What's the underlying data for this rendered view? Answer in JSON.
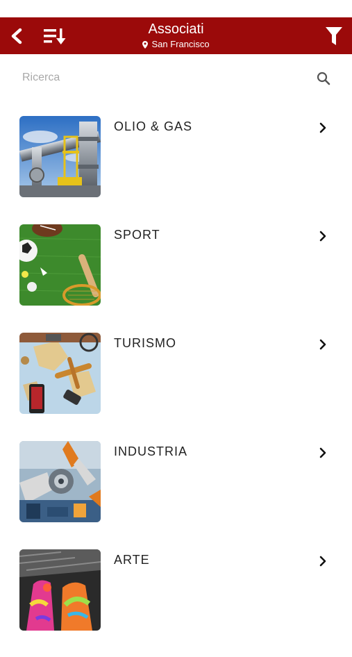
{
  "header": {
    "title": "Associati",
    "location": "San Francisco",
    "background_color": "#9b0a0a",
    "icons": [
      "back-arrow-icon",
      "sort-icon",
      "filter-icon",
      "map-pin-icon"
    ]
  },
  "search": {
    "placeholder": "Ricerca",
    "value": ""
  },
  "categories": [
    {
      "label": "OLIO & GAS",
      "image": "oil-gas-pipes-image"
    },
    {
      "label": "SPORT",
      "image": "sports-equipment-image"
    },
    {
      "label": "TURISMO",
      "image": "travel-map-image"
    },
    {
      "label": "INDUSTRIA",
      "image": "industrial-robots-image"
    },
    {
      "label": "ARTE",
      "image": "painted-hands-image"
    }
  ]
}
